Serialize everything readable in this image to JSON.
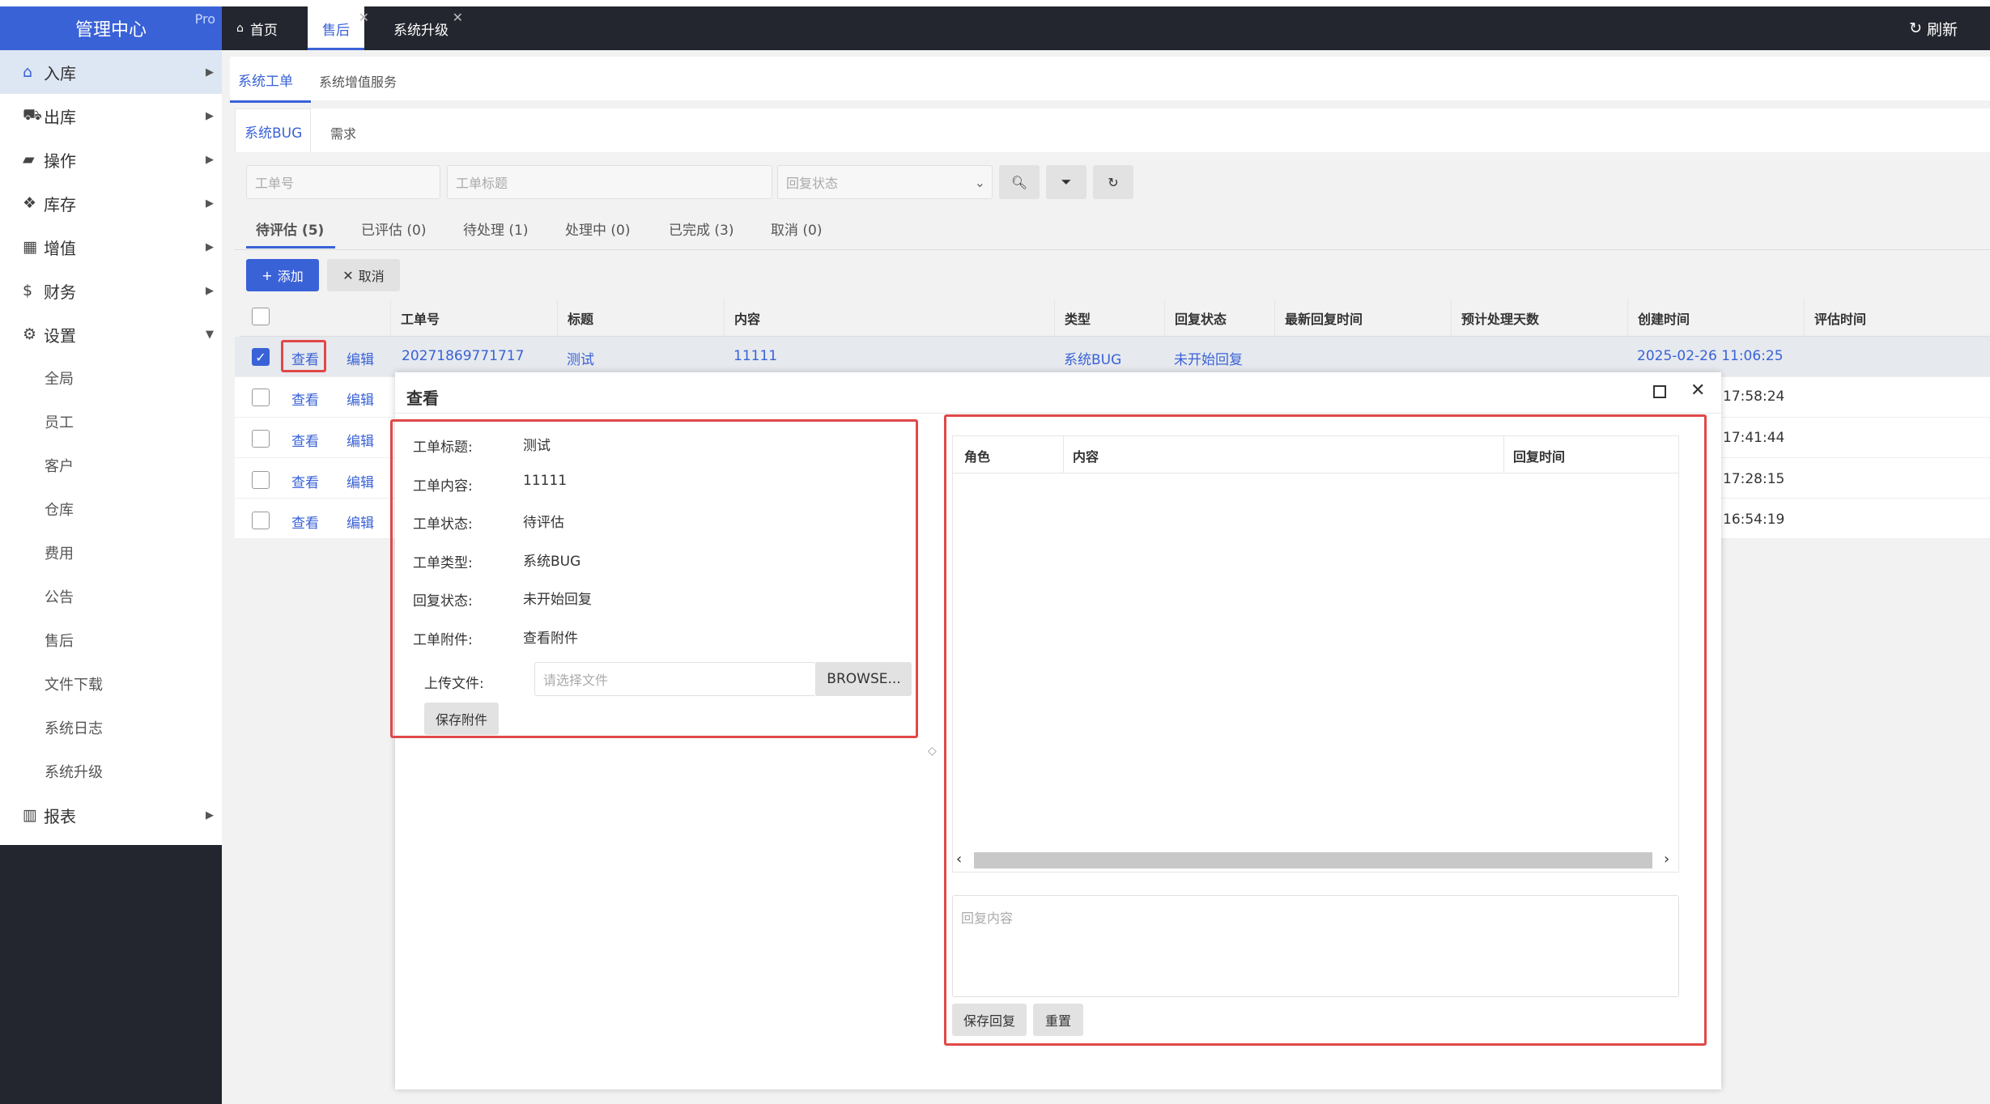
{
  "header": {
    "brand": "管理中心",
    "brand_badge": "Pro",
    "tabs": [
      {
        "label": "首页"
      },
      {
        "label": "售后"
      },
      {
        "label": "系统升级"
      }
    ],
    "refresh": "刷新"
  },
  "sidebar": {
    "items": [
      {
        "label": "入库",
        "icon": "inbox-icon"
      },
      {
        "label": "出库",
        "icon": "truck-icon"
      },
      {
        "label": "操作",
        "icon": "briefcase-icon"
      },
      {
        "label": "库存",
        "icon": "cubes-icon"
      },
      {
        "label": "增值",
        "icon": "grid-icon"
      },
      {
        "label": "财务",
        "icon": "dollar-icon"
      },
      {
        "label": "设置",
        "icon": "gears-icon"
      }
    ],
    "settings_sub": [
      "全局",
      "员工",
      "客户",
      "仓库",
      "费用",
      "公告",
      "售后",
      "文件下载",
      "系统日志",
      "系统升级"
    ],
    "report": "报表"
  },
  "subnav": {
    "tabs": [
      "系统工单",
      "系统增值服务"
    ]
  },
  "type_tabs": [
    "系统BUG",
    "需求"
  ],
  "filters": {
    "ticket_no": "工单号",
    "ticket_title": "工单标题",
    "reply_status": "回复状态"
  },
  "status_tabs": [
    "待评估 (5)",
    "已评估 (0)",
    "待处理 (1)",
    "处理中 (0)",
    "已完成 (3)",
    "取消 (0)"
  ],
  "actions": {
    "add": "添加",
    "cancel": "取消"
  },
  "table": {
    "columns": [
      "工单号",
      "标题",
      "内容",
      "类型",
      "回复状态",
      "最新回复时间",
      "预计处理天数",
      "创建时间",
      "评估时间"
    ],
    "view": "查看",
    "edit": "编辑",
    "rows": [
      {
        "no": "20271869771717",
        "title": "测试",
        "content": "11111",
        "type": "系统BUG",
        "reply": "未开始回复",
        "created": "2025-02-26 11:06:25",
        "checked": true
      },
      {
        "created_tail": "17:58:24"
      },
      {
        "created_tail": "17:41:44"
      },
      {
        "created_tail": "17:28:15"
      },
      {
        "created_tail": "16:54:19"
      }
    ]
  },
  "modal": {
    "title": "查看",
    "fields": [
      {
        "label": "工单标题:",
        "value": "测试"
      },
      {
        "label": "工单内容:",
        "value": "11111"
      },
      {
        "label": "工单状态:",
        "value": "待评估"
      },
      {
        "label": "工单类型:",
        "value": "系统BUG"
      },
      {
        "label": "回复状态:",
        "value": "未开始回复"
      },
      {
        "label": "工单附件:",
        "value": "查看附件"
      }
    ],
    "upload_label": "上传文件:",
    "upload_placeholder": "请选择文件",
    "browse": "BROWSE...",
    "save_attachment": "保存附件",
    "reply_table": {
      "columns": [
        "角色",
        "内容",
        "回复时间"
      ]
    },
    "reply_placeholder": "回复内容",
    "save_reply": "保存回复",
    "reset": "重置"
  },
  "colors": {
    "accent": "#3a62d7",
    "dark": "#23262e",
    "highlight": "#e04848"
  }
}
